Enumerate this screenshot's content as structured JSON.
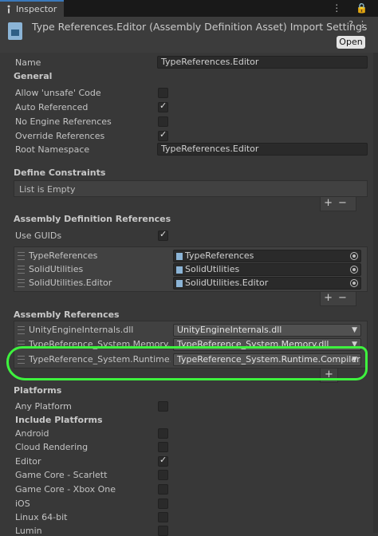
{
  "tab": {
    "title": "Inspector",
    "tools": "⋮ 🔒"
  },
  "header": {
    "title": "Type References.Editor (Assembly Definition Asset) Import Settings",
    "help_icon": "?",
    "menu_icon": "⋮",
    "open_label": "Open"
  },
  "name_row": {
    "label": "Name",
    "value": "TypeReferences.Editor"
  },
  "general": {
    "title": "General",
    "allow_unsafe": {
      "label": "Allow 'unsafe' Code",
      "checked": false
    },
    "auto_referenced": {
      "label": "Auto Referenced",
      "checked": true
    },
    "no_engine_refs": {
      "label": "No Engine References",
      "checked": false
    },
    "override_refs": {
      "label": "Override References",
      "checked": true
    },
    "root_namespace": {
      "label": "Root Namespace",
      "value": "TypeReferences.Editor"
    }
  },
  "define_constraints": {
    "title": "Define Constraints",
    "empty_text": "List is Empty",
    "add": "+",
    "remove": "−"
  },
  "asm_def_refs": {
    "title": "Assembly Definition References",
    "use_guids": {
      "label": "Use GUIDs",
      "checked": true
    },
    "items": [
      {
        "name": "TypeReferences",
        "value": "TypeReferences"
      },
      {
        "name": "SolidUtilities",
        "value": "SolidUtilities"
      },
      {
        "name": "SolidUtilities.Editor",
        "value": "SolidUtilities.Editor"
      }
    ],
    "add": "+",
    "remove": "−"
  },
  "asm_refs": {
    "title": "Assembly References",
    "items": [
      {
        "name": "UnityEngineInternals.dll",
        "value": "UnityEngineInternals.dll"
      },
      {
        "name": "TypeReference_System.Memory.dll",
        "value": "TypeReference_System.Memory.dll"
      },
      {
        "name": "TypeReference_System.Runtime.Co",
        "value": "TypeReference_System.Runtime.CompilerSe"
      }
    ],
    "add": "+"
  },
  "platforms": {
    "title": "Platforms",
    "any_platform": {
      "label": "Any Platform",
      "checked": false
    },
    "include_title": "Include Platforms",
    "items": [
      {
        "label": "Android",
        "checked": false
      },
      {
        "label": "Cloud Rendering",
        "checked": false
      },
      {
        "label": "Editor",
        "checked": true
      },
      {
        "label": "Game Core - Scarlett",
        "checked": false
      },
      {
        "label": "Game Core - Xbox One",
        "checked": false
      },
      {
        "label": "iOS",
        "checked": false
      },
      {
        "label": "Linux 64-bit",
        "checked": false
      },
      {
        "label": "Lumin",
        "checked": false
      }
    ]
  },
  "colors": {
    "highlight": "#3ef23e",
    "background": "#383838",
    "accent": "#3a79bb"
  }
}
